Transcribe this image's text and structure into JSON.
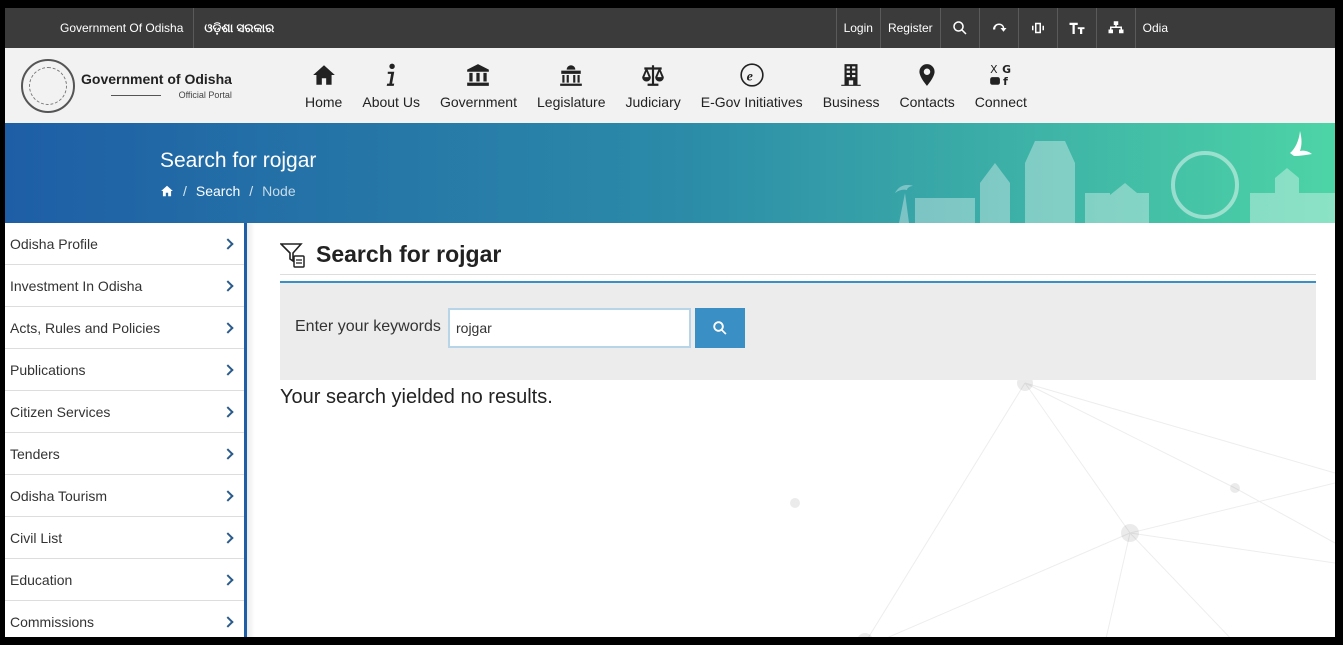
{
  "topbar": {
    "gov_label": "Government Of Odisha",
    "odia_label": "ଓଡ଼ିଶା ସରକାର",
    "login": "Login",
    "register": "Register",
    "language": "Odia",
    "icons": [
      "search-icon",
      "screen-reader-icon",
      "vibration-icon",
      "text-size-icon",
      "sitemap-icon"
    ]
  },
  "logo": {
    "title": "Government of Odisha",
    "subtitle": "Official Portal"
  },
  "nav": [
    {
      "label": "Home",
      "icon": "home-icon"
    },
    {
      "label": "About Us",
      "icon": "info-icon"
    },
    {
      "label": "Government",
      "icon": "government-building-icon"
    },
    {
      "label": "Legislature",
      "icon": "legislature-building-icon"
    },
    {
      "label": "Judiciary",
      "icon": "scales-icon"
    },
    {
      "label": "E-Gov Initiatives",
      "icon": "egov-icon"
    },
    {
      "label": "Business",
      "icon": "office-building-icon"
    },
    {
      "label": "Contacts",
      "icon": "location-pin-icon"
    },
    {
      "label": "Connect",
      "icon": "social-icon"
    }
  ],
  "banner": {
    "title": "Search for rojgar",
    "breadcrumb": [
      "Search",
      "Node"
    ]
  },
  "sidebar": {
    "items": [
      {
        "label": "Odisha Profile"
      },
      {
        "label": "Investment In Odisha"
      },
      {
        "label": "Acts, Rules and Policies"
      },
      {
        "label": "Publications"
      },
      {
        "label": "Citizen Services"
      },
      {
        "label": "Tenders"
      },
      {
        "label": "Odisha Tourism"
      },
      {
        "label": "Civil List"
      },
      {
        "label": "Education"
      },
      {
        "label": "Commissions"
      }
    ]
  },
  "main": {
    "heading": "Search for rojgar",
    "search_label": "Enter your keywords",
    "search_value": "rojgar",
    "no_results": "Your search yielded no results."
  },
  "colors": {
    "topbar": "#3b3b3b",
    "accent": "#3a8fc4",
    "sidebar_border": "#1e5ea6"
  }
}
